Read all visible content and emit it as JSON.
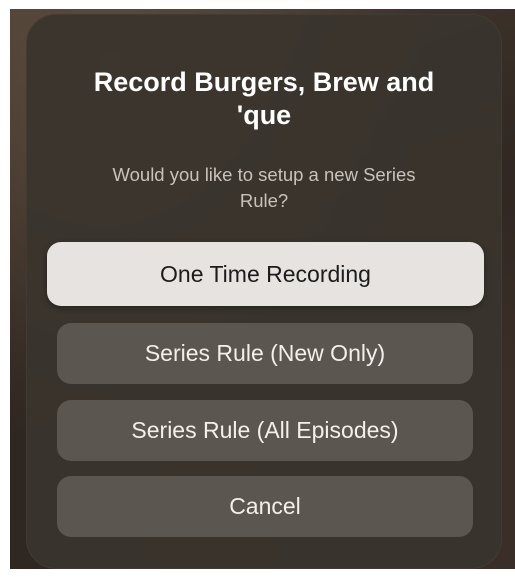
{
  "dialog": {
    "title": "Record Burgers, Brew and 'que",
    "subtitle": "Would you like to setup a new Series Rule?"
  },
  "buttons": {
    "one_time": "One Time Recording",
    "series_new": "Series Rule (New Only)",
    "series_all": "Series Rule (All Episodes)",
    "cancel": "Cancel"
  },
  "colors": {
    "dialog_background": "#3a342e",
    "focused_button": "#e6e3e0",
    "button_background": "#5c5650"
  }
}
